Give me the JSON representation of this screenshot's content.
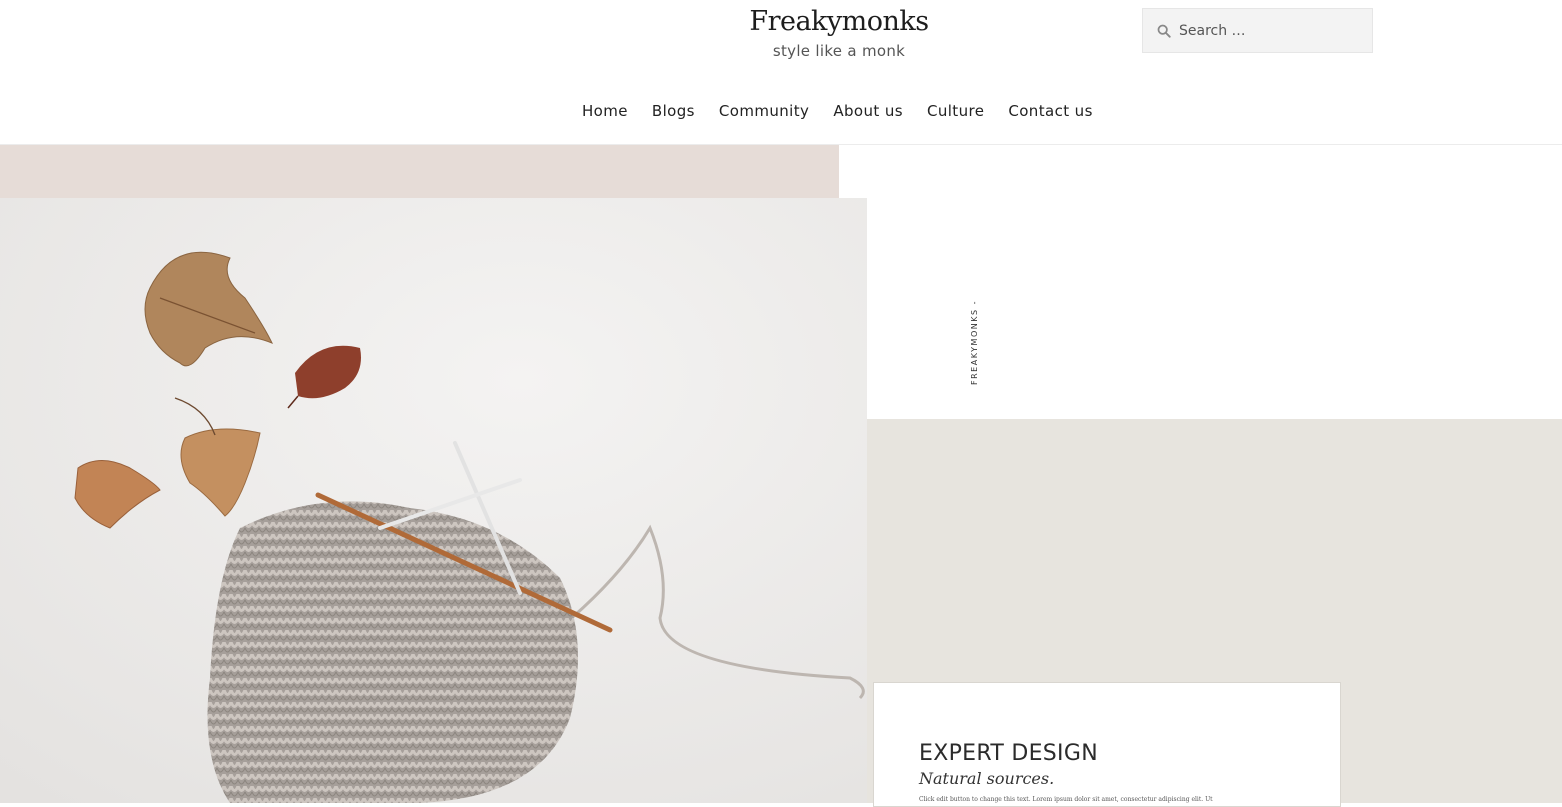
{
  "header": {
    "site_title": "Freakymonks",
    "tagline": "style like a monk",
    "search": {
      "placeholder": "Search …",
      "icon": "search-icon"
    }
  },
  "nav": {
    "items": [
      {
        "label": "Home"
      },
      {
        "label": "Blogs"
      },
      {
        "label": "Community"
      },
      {
        "label": "About us"
      },
      {
        "label": "Culture"
      },
      {
        "label": "Contact us"
      }
    ]
  },
  "hero": {
    "vertical_label": "FREAKYMONKS -",
    "photo_alt": "knitting-with-autumn-leaves",
    "colors": {
      "pink_band": "#e6dcd7",
      "beige": "#e7e4de",
      "photo_bg": "#eeedec"
    }
  },
  "feature_card": {
    "title": "EXPERT DESIGN",
    "subtitle": "Natural sources.",
    "body": "Click edit button to change this text. Lorem ipsum dolor sit amet, consectetur adipiscing elit. Ut"
  }
}
